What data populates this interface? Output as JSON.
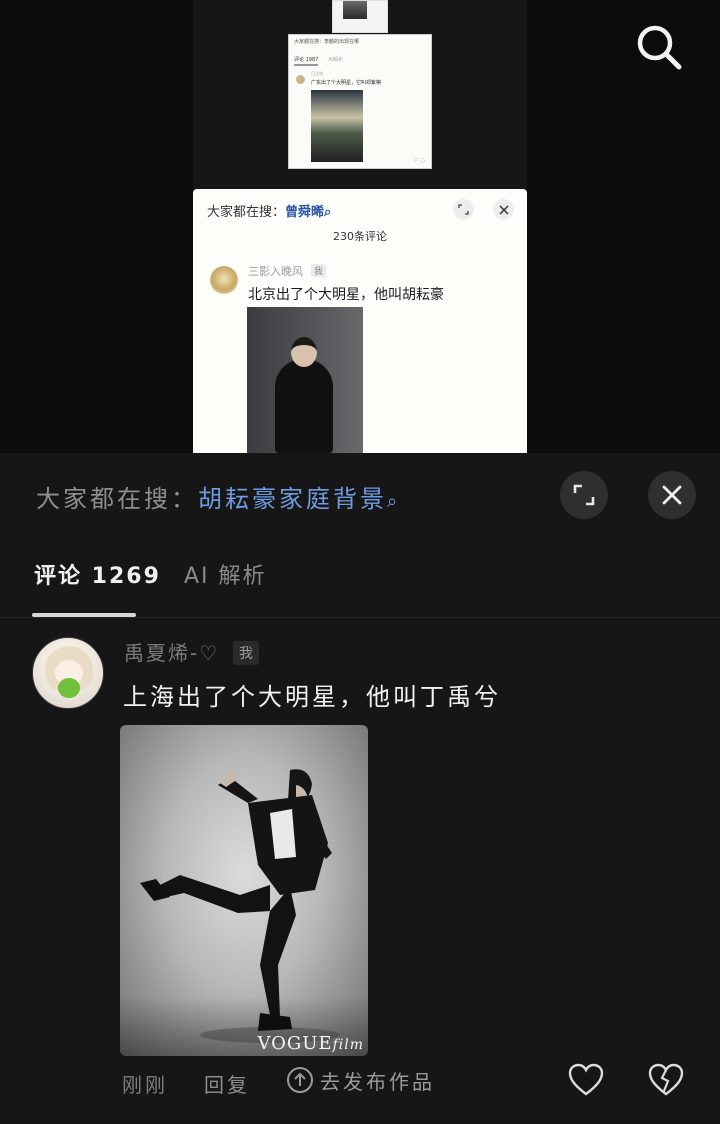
{
  "preview_stack": {
    "mini_card": {
      "search_text": "大家都在搜：李鹏的出现在哪",
      "tab_comments": "评论 1987",
      "tab_ai": "AI解析",
      "user_name": "已注销",
      "comment_text": "广东出了个大明星，它叫邓紫棋"
    },
    "card": {
      "search_prefix": "大家都在搜：",
      "search_keyword": "曾舜晞",
      "comment_count": "230条评论",
      "user_name": "三影入晚风",
      "me_badge": "我",
      "comment_text": "北京出了个大明星，他叫胡耘豪"
    }
  },
  "panel": {
    "search_prefix": "大家都在搜：",
    "search_keyword": "胡耘豪家庭背景",
    "tabs": [
      {
        "label": "评论 1269",
        "active": true
      },
      {
        "label": "AI 解析",
        "active": false
      }
    ],
    "comment": {
      "user_name": "禹夏烯-♡",
      "me_badge": "我",
      "text": "上海出了个大明星，他叫丁禹兮",
      "photo_watermark": "VOGUE",
      "photo_watermark_suffix": "film",
      "time": "刚刚",
      "reply_label": "回复",
      "publish_label": "去发布作品"
    }
  },
  "icons": {
    "top_right": "search-icon",
    "expand": "expand-icon",
    "close": "close-icon",
    "like": "heart-icon",
    "dislike": "broken-heart-icon",
    "publish": "arrow-up-circle-icon"
  },
  "colors": {
    "keyword_blue": "#6f9be0",
    "panel_bg": "#161617"
  }
}
